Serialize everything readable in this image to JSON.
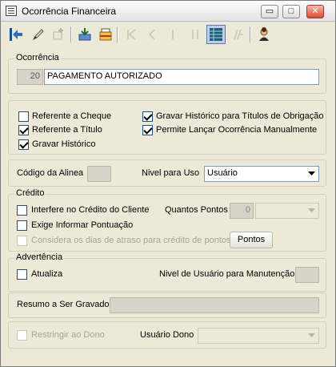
{
  "window": {
    "title": "Ocorrência Financeira"
  },
  "titlebar_buttons": {
    "minimize": "▭",
    "maximize": "□",
    "close": "✕"
  },
  "ocorrencia": {
    "group_label": "Ocorrência",
    "code": "20",
    "description": "PAGAMENTO AUTORIZADO"
  },
  "options": {
    "referente_cheque": {
      "label": "Referente a Cheque",
      "checked": false
    },
    "referente_titulo": {
      "label": "Referente a Título",
      "checked": true
    },
    "gravar_historico": {
      "label": "Gravar Histórico",
      "checked": true
    },
    "gravar_historico_titulos": {
      "label": "Gravar Histórico para Títulos de Obrigação",
      "checked": true
    },
    "permite_lancar": {
      "label": "Permite Lançar Ocorrência Manualmente",
      "checked": true
    }
  },
  "codigo_alinea": {
    "label": "Código da Alinea",
    "value": ""
  },
  "nivel_uso": {
    "label": "Nivel para Uso",
    "value": "Usuário"
  },
  "credito": {
    "group_label": "Crédito",
    "interfere": {
      "label": "Interfere no Crédito do Cliente",
      "checked": false
    },
    "quantos_pontos_label": "Quantos Pontos",
    "quantos_pontos_value": "0",
    "exige_pontuacao": {
      "label": "Exige Informar Pontuação",
      "checked": false
    },
    "considera_dias": {
      "label": "Considera os dias de atraso para crédito de pontos",
      "checked": false
    },
    "pontos_button": "Pontos"
  },
  "advertencia": {
    "group_label": "Advertência",
    "atualiza": {
      "label": "Atualiza",
      "checked": false
    },
    "nivel_manutencao_label": "Nivel de Usuário para Manutenção",
    "nivel_manutencao_value": ""
  },
  "resumo": {
    "label": "Resumo a Ser Gravado",
    "value": ""
  },
  "dono": {
    "restringir": {
      "label": "Restringir ao Dono",
      "checked": false
    },
    "usuario_label": "Usuário Dono",
    "usuario_value": ""
  },
  "colors": {
    "accent": "#1c5180",
    "window_bg": "#ece9d8",
    "close_btn": "#d84b2e"
  }
}
